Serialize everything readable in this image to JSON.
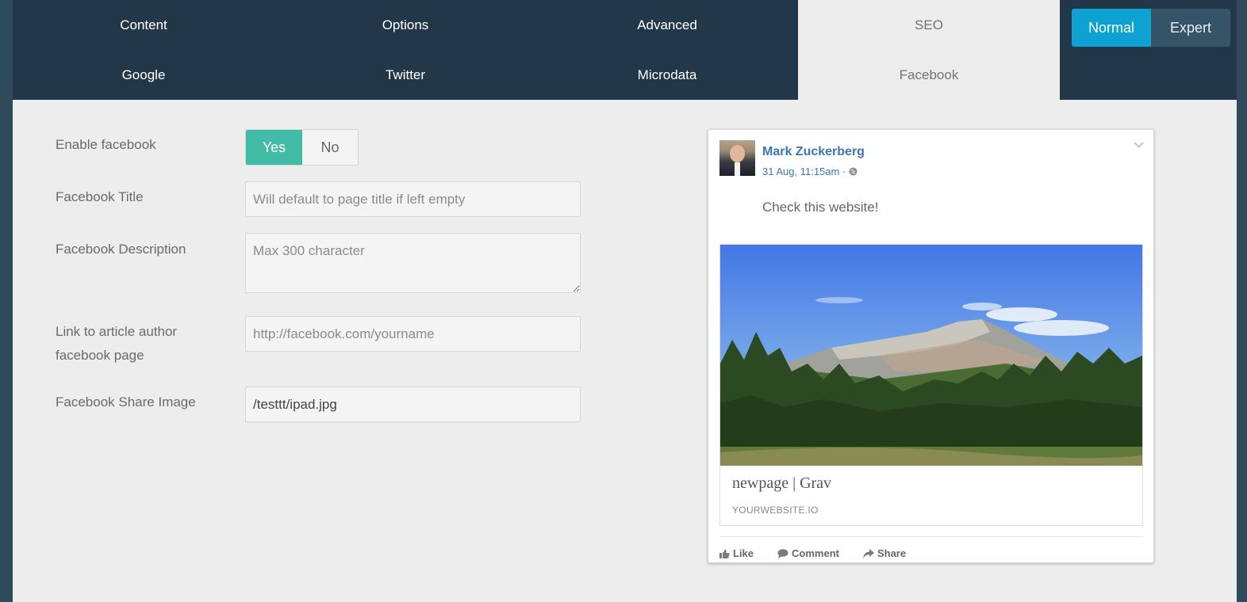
{
  "tabs": {
    "row1": [
      "Content",
      "Options",
      "Advanced",
      "SEO"
    ],
    "row2": [
      "Google",
      "Twitter",
      "Microdata",
      "Facebook"
    ]
  },
  "mode": {
    "normal": "Normal",
    "expert": "Expert"
  },
  "form": {
    "enable_label": "Enable facebook",
    "enable_yes": "Yes",
    "enable_no": "No",
    "title_label": "Facebook Title",
    "title_placeholder": "Will default to page title if left empty",
    "description_label": "Facebook Description",
    "description_placeholder": "Max 300 character",
    "author_label": "Link to article author facebook page",
    "author_placeholder": "http://facebook.com/yourname",
    "image_label": "Facebook Share Image",
    "image_value": "/testtt/ipad.jpg"
  },
  "preview": {
    "author": "Mark Zuckerberg",
    "date": "31 Aug, 11:15am · ",
    "post_text": "Check this website!",
    "link_title": "newpage | Grav",
    "link_domain": "YOURWEBSITE.IO",
    "like": "Like",
    "comment": "Comment",
    "share": "Share"
  }
}
